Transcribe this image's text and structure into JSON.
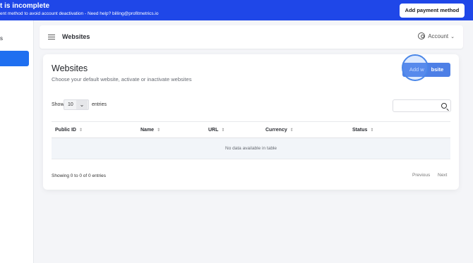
{
  "banner": {
    "title": "t is incomplete",
    "subtitle": "ent method to avoid account deactivation - Need help? billing@profitmetrics.io",
    "button_label": "Add payment method"
  },
  "sidebar": {
    "partial_label": "s"
  },
  "topbar": {
    "menu_icon": "hamburger-icon",
    "title": "Websites",
    "account_label": "Account",
    "account_icon": "user-circle-icon"
  },
  "card": {
    "title": "Websites",
    "subtitle": "Choose your default website, activate or inactivate websites",
    "add_button_prefix": "Add w",
    "add_button_suffix": "bsite"
  },
  "table_controls": {
    "show_label": "Show",
    "page_size": "10",
    "entries_label": "entries",
    "search_value": ""
  },
  "table": {
    "columns": [
      "Public ID",
      "Name",
      "URL",
      "Currency",
      "Status"
    ],
    "empty_message": "No data available in table"
  },
  "footer": {
    "info": "Showing 0 to 0 of 0 entries",
    "previous": "Previous",
    "next": "Next"
  },
  "colors": {
    "banner_bg": "#1f47e8",
    "accent": "#1f6ff0",
    "add_button_bg": "#4d7fe6"
  }
}
